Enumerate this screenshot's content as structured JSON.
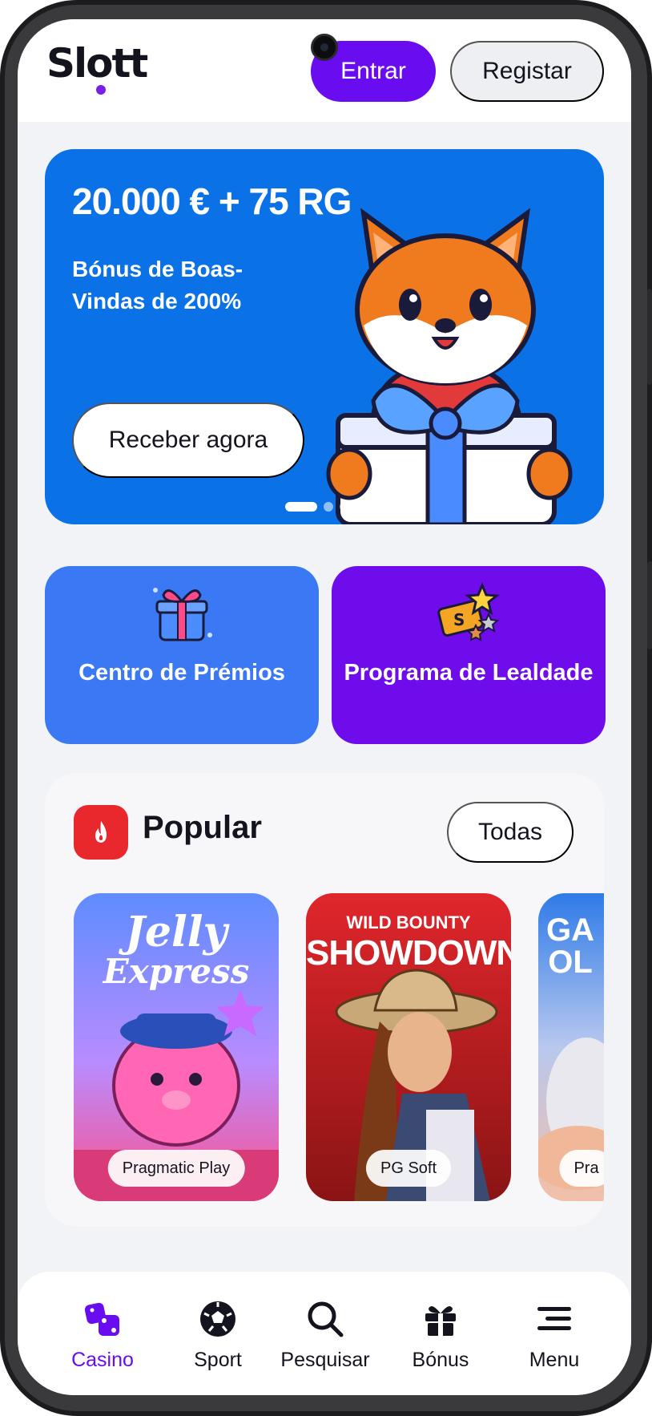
{
  "header": {
    "logo": "Slott",
    "login_label": "Entrar",
    "register_label": "Registar"
  },
  "banner": {
    "amount": "20.000 € + 75 RG",
    "subtitle": "Bónus de Boas-Vindas de 200%",
    "cta_label": "Receber agora",
    "slide_count": 3,
    "active_slide": 1
  },
  "cards": [
    {
      "label": "Centro de Prémios",
      "icon": "gift-box-icon",
      "color": "#3a78f4"
    },
    {
      "label": "Programa de Lealdade",
      "icon": "loyalty-ticket-icon",
      "color": "#6f0cec"
    }
  ],
  "popular": {
    "title": "Popular",
    "all_label": "Todas",
    "games": [
      {
        "title_line1": "Jelly",
        "title_line2": "Express",
        "provider": "Pragmatic Play"
      },
      {
        "title_line1": "WILD BOUNTY",
        "title_line2": "SHOWDOWN",
        "provider": "PG Soft"
      },
      {
        "title_line1": "GA",
        "title_line2": "OL",
        "provider": "Pra"
      }
    ]
  },
  "nav": {
    "items": [
      {
        "label": "Casino",
        "icon": "dice-icon",
        "active": true
      },
      {
        "label": "Sport",
        "icon": "soccer-ball-icon",
        "active": false
      },
      {
        "label": "Pesquisar",
        "icon": "search-icon",
        "active": false
      },
      {
        "label": "Bónus",
        "icon": "gift-icon",
        "active": false
      },
      {
        "label": "Menu",
        "icon": "menu-icon",
        "active": false
      }
    ]
  },
  "colors": {
    "brand_purple": "#6a0cf0",
    "banner_blue": "#0a72e6",
    "popular_red": "#e8282d"
  }
}
